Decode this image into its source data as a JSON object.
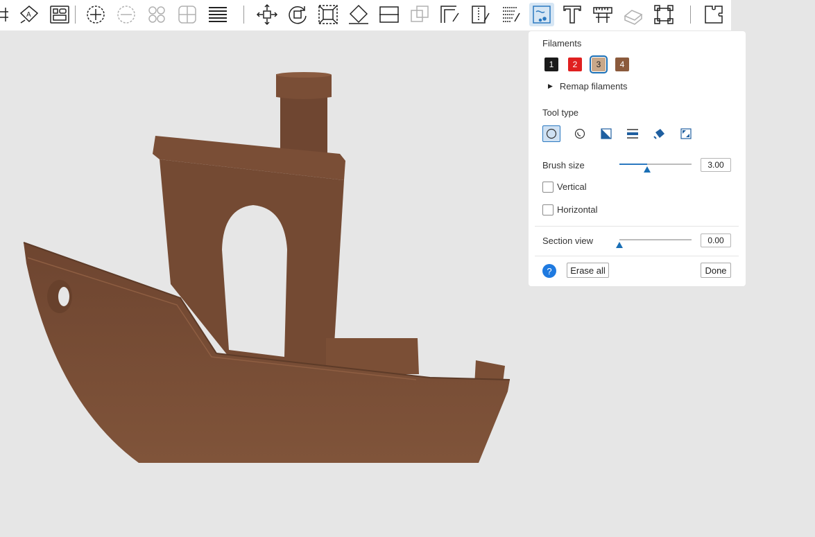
{
  "toolbar": {
    "buttons": [
      {
        "icon": "grid-arrange-icon"
      },
      {
        "icon": "auto-orient-icon"
      },
      {
        "icon": "arrange-plates-icon"
      },
      {
        "icon": "add-instance-icon"
      },
      {
        "icon": "remove-instance-icon"
      },
      {
        "icon": "split-objects-icon"
      },
      {
        "icon": "split-parts-icon"
      },
      {
        "icon": "layers-icon"
      },
      {
        "icon": "move-icon"
      },
      {
        "icon": "rotate-icon"
      },
      {
        "icon": "scale-icon"
      },
      {
        "icon": "lay-on-face-icon"
      },
      {
        "icon": "cut-icon"
      },
      {
        "icon": "mesh-boolean-icon"
      },
      {
        "icon": "support-painting-icon"
      },
      {
        "icon": "seam-painting-icon"
      },
      {
        "icon": "fuzzy-skin-painting-icon"
      },
      {
        "icon": "color-painting-icon"
      },
      {
        "icon": "text-shape-icon"
      },
      {
        "icon": "measure-icon"
      },
      {
        "icon": "assembly-icon"
      },
      {
        "icon": "brim-ears-icon"
      },
      {
        "icon": "assembly-view-icon"
      }
    ]
  },
  "panel": {
    "filaments_title": "Filaments",
    "filaments": [
      {
        "label": "1",
        "color": "#1a1a1a"
      },
      {
        "label": "2",
        "color": "#e02020"
      },
      {
        "label": "3",
        "color": "#c9a88a"
      },
      {
        "label": "4",
        "color": "#8b5a3c"
      }
    ],
    "remap_label": "Remap filaments",
    "tool_type_title": "Tool type",
    "tools": [
      "circle-brush-icon",
      "sphere-brush-icon",
      "triangle-fill-icon",
      "height-range-icon",
      "fill-bucket-icon",
      "gap-fill-icon"
    ],
    "brush_size_label": "Brush size",
    "brush_size_value": "3.00",
    "brush_size_fraction": 0.38,
    "vertical_label": "Vertical",
    "horizontal_label": "Horizontal",
    "section_view_label": "Section view",
    "section_view_value": "0.00",
    "section_view_fraction": 0.0,
    "help_label": "?",
    "erase_all_label": "Erase all",
    "done_label": "Done"
  },
  "colors": {
    "accent": "#1a6fb5",
    "model": "#7b4f36",
    "viewport": "#e6e6e6"
  }
}
